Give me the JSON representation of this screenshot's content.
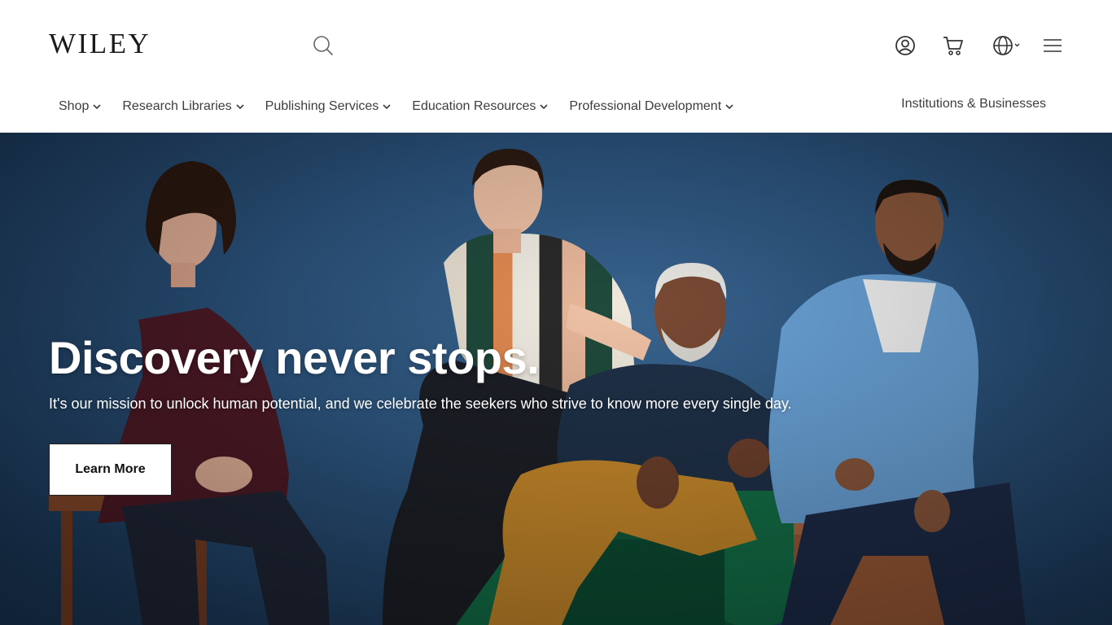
{
  "brand": {
    "logo_text": "WILEY"
  },
  "header": {
    "icons": {
      "search": "search-icon",
      "account": "user-circle-icon",
      "cart": "shopping-cart-icon",
      "language": "globe-icon",
      "menu": "hamburger-menu-icon"
    },
    "nav": [
      {
        "label": "Shop"
      },
      {
        "label": "Research Libraries"
      },
      {
        "label": "Publishing Services"
      },
      {
        "label": "Education Resources"
      },
      {
        "label": "Professional Development"
      }
    ],
    "nav_right": "Institutions & Businesses"
  },
  "hero": {
    "title": "Discovery never stops.",
    "subtitle": "It's our mission to unlock human potential, and we celebrate the seekers who strive to know more every single day.",
    "cta_label": "Learn More"
  },
  "colors": {
    "hero_background": "#2d5680",
    "text_dark": "#3d3d3d",
    "cta_background": "#ffffff"
  }
}
